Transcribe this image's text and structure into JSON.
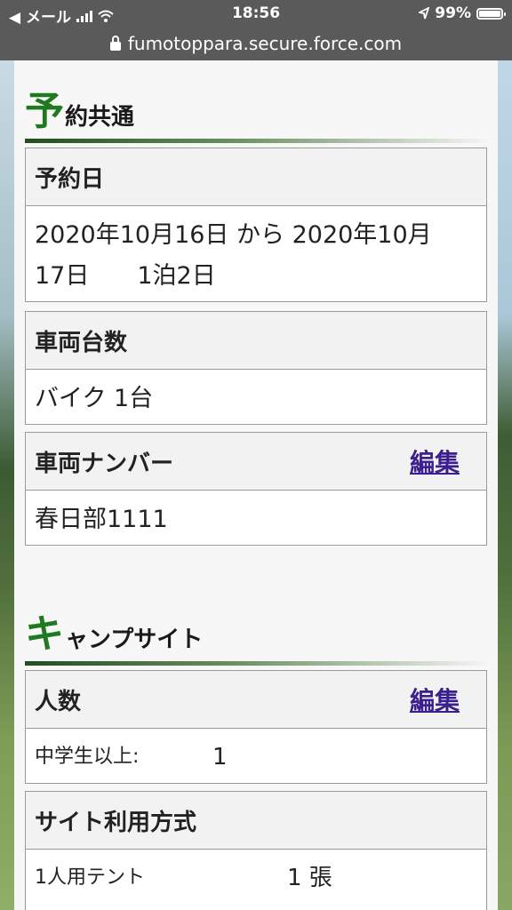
{
  "status_bar": {
    "back_label": "◀ メール",
    "time": "18:56",
    "battery": "99%"
  },
  "url_bar": {
    "url": "fumotoppara.secure.force.com"
  },
  "reservation": {
    "title_initial": "予",
    "title_rest": "約共通",
    "date_box": {
      "header": "予約日",
      "line1": "2020年10月16日 から 2020年10月",
      "line2": "17日　　1泊2日"
    },
    "vehicle_count_box": {
      "header": "車両台数",
      "value": "バイク 1台"
    },
    "vehicle_number_box": {
      "header": "車両ナンバー",
      "edit_label": "編集",
      "value": "春日部1111"
    }
  },
  "campsite": {
    "title_initial": "キ",
    "title_rest": "ャンプサイト",
    "people_box": {
      "header": "人数",
      "edit_label": "編集",
      "row_label": "中学生以上:",
      "row_value": "1"
    },
    "site_usage_box": {
      "header": "サイト利用方式",
      "row_label": "1人用テント",
      "row_value": "1 張"
    }
  },
  "icons": [
    "wifi-icon",
    "location-arrow-icon",
    "battery-icon",
    "lock-icon",
    "signal-icon"
  ]
}
